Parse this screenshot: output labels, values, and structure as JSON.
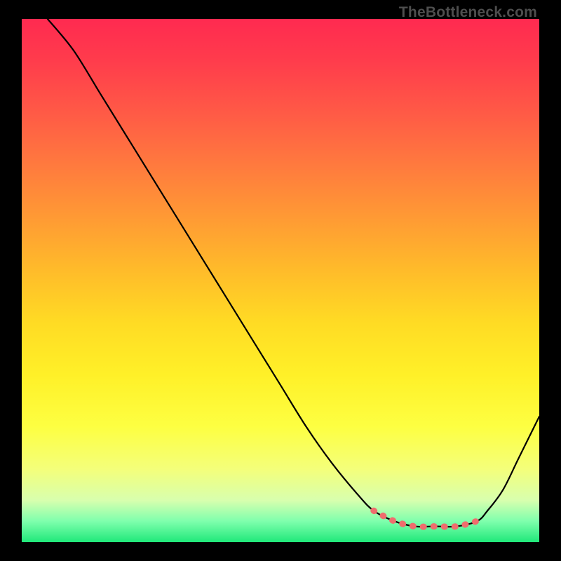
{
  "watermark": "TheBottleneck.com",
  "chart_data": {
    "type": "line",
    "title": "",
    "xlabel": "",
    "ylabel": "",
    "xlim": [
      0,
      100
    ],
    "ylim": [
      0,
      100
    ],
    "grid": false,
    "series": [
      {
        "name": "curve",
        "color": "#000000",
        "x": [
          5,
          10,
          15,
          20,
          25,
          30,
          35,
          40,
          45,
          50,
          55,
          60,
          65,
          68,
          72,
          76,
          80,
          84,
          88,
          90,
          93,
          96,
          100
        ],
        "y": [
          100,
          94,
          86,
          78,
          70,
          62,
          54,
          46,
          38,
          30,
          22,
          15,
          9,
          6,
          4,
          3,
          3,
          3,
          4,
          6,
          10,
          16,
          24
        ]
      },
      {
        "name": "highlight",
        "color": "#ef6d6d",
        "x": [
          68,
          72,
          76,
          80,
          84,
          88
        ],
        "y": [
          6,
          4,
          3,
          3,
          3,
          4
        ]
      }
    ]
  }
}
